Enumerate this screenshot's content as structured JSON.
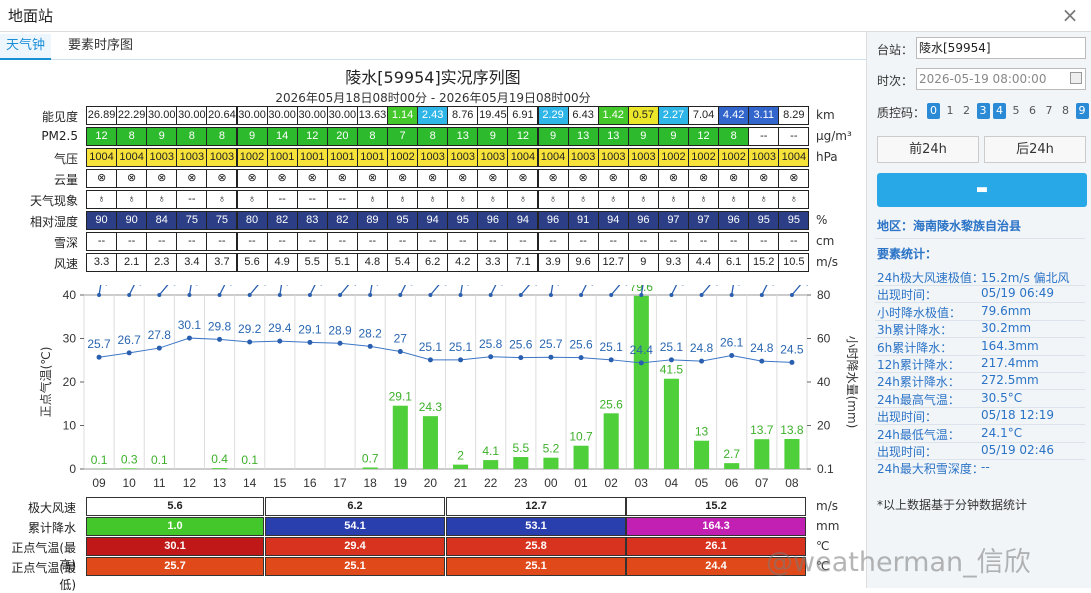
{
  "window": {
    "title": "地面站",
    "close": "×"
  },
  "tabs": [
    "天气钟",
    "要素时序图"
  ],
  "chart_title": "陵水[59954]实况序列图",
  "chart_subtitle": "2026年05月18日08时00分 - 2026年05月19日08时00分",
  "hours": [
    "09",
    "10",
    "11",
    "12",
    "13",
    "14",
    "15",
    "16",
    "17",
    "18",
    "19",
    "20",
    "21",
    "22",
    "23",
    "00",
    "01",
    "02",
    "03",
    "04",
    "05",
    "06",
    "07",
    "08"
  ],
  "table": {
    "rows": [
      {
        "label": "能见度",
        "unit": "km",
        "values": [
          "26.89",
          "22.29",
          "30.00",
          "30.00",
          "20.64",
          "30.00",
          "30.00",
          "30.00",
          "30.00",
          "13.63",
          "1.14",
          "2.43",
          "8.76",
          "19.45",
          "6.91",
          "2.29",
          "6.43",
          "1.42",
          "0.57",
          "2.27",
          "7.04",
          "4.42",
          "3.11",
          "8.29"
        ],
        "colors": [
          "#fff",
          "#fff",
          "#fff",
          "#fff",
          "#fff",
          "#fff",
          "#fff",
          "#fff",
          "#fff",
          "#fff",
          "#44c72a",
          "#2fb6e8",
          "#fff",
          "#fff",
          "#fff",
          "#2fb6e8",
          "#fff",
          "#44c72a",
          "#ece62a",
          "#2fb6e8",
          "#fff",
          "#3366cc",
          "#3366cc",
          "#fff"
        ]
      },
      {
        "label": "PM2.5",
        "unit": "μg/m³",
        "values": [
          "12",
          "8",
          "9",
          "8",
          "8",
          "9",
          "14",
          "12",
          "20",
          "8",
          "7",
          "8",
          "13",
          "9",
          "12",
          "9",
          "13",
          "13",
          "9",
          "9",
          "12",
          "8",
          "--",
          "--"
        ],
        "colors": "green"
      },
      {
        "label": "气压",
        "unit": "hPa",
        "values": [
          "1004",
          "1004",
          "1003",
          "1003",
          "1003",
          "1002",
          "1001",
          "1001",
          "1001",
          "1001",
          "1002",
          "1003",
          "1003",
          "1003",
          "1004",
          "1004",
          "1003",
          "1003",
          "1003",
          "1002",
          "1002",
          "1002",
          "1003",
          "1004"
        ],
        "colors": "yellow"
      },
      {
        "label": "云量",
        "unit": "",
        "values": [
          "⊗",
          "⊗",
          "⊗",
          "⊗",
          "⊗",
          "⊗",
          "⊗",
          "⊗",
          "⊗",
          "⊗",
          "⊗",
          "⊗",
          "⊗",
          "⊗",
          "⊗",
          "⊗",
          "⊗",
          "⊗",
          "⊗",
          "⊗",
          "⊗",
          "⊗",
          "⊗",
          "⊗"
        ],
        "colors": "white"
      },
      {
        "label": "天气现象",
        "unit": "",
        "values": [
          "♁",
          "♁",
          "♁",
          "--",
          "♁",
          "♁",
          "--",
          "--",
          "--",
          "♁",
          "♁",
          "♁",
          "♁",
          "♁",
          "♁",
          "♁",
          "♁",
          "♁",
          "♁",
          "♁",
          "♁",
          "♁",
          "♁",
          "♁"
        ],
        "colors": "white"
      },
      {
        "label": "相对湿度",
        "unit": "%",
        "values": [
          "90",
          "90",
          "84",
          "75",
          "75",
          "80",
          "82",
          "83",
          "82",
          "89",
          "95",
          "94",
          "95",
          "96",
          "94",
          "96",
          "91",
          "94",
          "96",
          "97",
          "97",
          "96",
          "95",
          "95"
        ],
        "colors": "navy"
      },
      {
        "label": "雪深",
        "unit": "cm",
        "values": [
          "--",
          "--",
          "--",
          "--",
          "--",
          "--",
          "--",
          "--",
          "--",
          "--",
          "--",
          "--",
          "--",
          "--",
          "--",
          "--",
          "--",
          "--",
          "--",
          "--",
          "--",
          "--",
          "--",
          "--"
        ],
        "colors": "white"
      },
      {
        "label": "风速",
        "unit": "m/s",
        "values": [
          "3.3",
          "2.1",
          "2.3",
          "3.4",
          "3.7",
          "5.6",
          "4.9",
          "5.5",
          "5.1",
          "4.8",
          "5.4",
          "6.2",
          "4.2",
          "3.3",
          "7.1",
          "3.9",
          "9.6",
          "12.7",
          "9",
          "9.3",
          "4.4",
          "6.1",
          "15.2",
          "10.5"
        ],
        "colors": "white"
      }
    ]
  },
  "chart_data": {
    "type": "bar",
    "categories": [
      "09",
      "10",
      "11",
      "12",
      "13",
      "14",
      "15",
      "16",
      "17",
      "18",
      "19",
      "20",
      "21",
      "22",
      "23",
      "00",
      "01",
      "02",
      "03",
      "04",
      "05",
      "06",
      "07",
      "08"
    ],
    "series": [
      {
        "name": "小时降水量",
        "values": [
          0.1,
          0.3,
          0.1,
          0,
          0.4,
          0.1,
          0,
          0,
          0,
          0.7,
          29.1,
          24.3,
          2,
          4.1,
          5.5,
          5.2,
          10.7,
          25.6,
          79.6,
          41.5,
          13,
          2.7,
          13.7,
          13.8
        ],
        "labels": [
          "0.1",
          "0.3",
          "0.1",
          "",
          "0.4",
          "0.1",
          "",
          "",
          "",
          "0.7",
          "29.1",
          "24.3",
          "2",
          "4.1",
          "5.5",
          "5.2",
          "10.7",
          "25.6",
          "79.6",
          "41.5",
          "13",
          "2.7",
          "13.7",
          "13.8"
        ]
      },
      {
        "name": "正点气温",
        "values": [
          25.7,
          26.7,
          27.8,
          30.1,
          29.8,
          29.2,
          29.4,
          29.1,
          28.9,
          28.2,
          27,
          25.1,
          25.1,
          25.8,
          25.6,
          25.7,
          25.6,
          25.1,
          24.4,
          25.1,
          24.8,
          26.1,
          24.8,
          24.5
        ],
        "labels": [
          "25.7",
          "26.7",
          "27.8",
          "30.1",
          "29.8",
          "29.2",
          "29.4",
          "29.1",
          "28.9",
          "28.2",
          "27",
          "25.1",
          "25.1",
          "25.8",
          "25.6",
          "25.7",
          "25.6",
          "25.1",
          "24.4",
          "25.1",
          "24.8",
          "26.1",
          "24.8",
          "24.5"
        ]
      }
    ],
    "ylabel_left": "正点气温(℃)",
    "ylabel_right": "小时降水量(mm)",
    "left_ticks": [
      "0",
      "10",
      "20",
      "30",
      "40"
    ],
    "right_ticks": [
      "0.1",
      "20",
      "40",
      "60",
      "80"
    ],
    "ylim_left": [
      0,
      40
    ],
    "ylim_right": [
      0,
      80
    ],
    "colors": {
      "bar": "#4fcf3a",
      "line": "#3c76c6",
      "label_bar": "#3db02a",
      "label_line": "#2a66b0"
    }
  },
  "bottom": {
    "rows": [
      {
        "label": "极大风速",
        "unit": "m/s",
        "values": [
          "5.6",
          "6.2",
          "12.7",
          "15.2"
        ],
        "colors": [
          "#fff",
          "#fff",
          "#fff",
          "#fff"
        ],
        "text": "#222"
      },
      {
        "label": "累计降水",
        "unit": "mm",
        "values": [
          "1.0",
          "54.1",
          "53.1",
          "164.3"
        ],
        "colors": [
          "#44c72a",
          "#2a3fae",
          "#2a3fae",
          "#c21fb3"
        ],
        "text": "#fff"
      },
      {
        "label": "正点气温(最高)",
        "unit": "℃",
        "values": [
          "30.1",
          "29.4",
          "25.8",
          "26.1"
        ],
        "colors": [
          "#c01818",
          "#d8331f",
          "#d8331f",
          "#d8331f"
        ],
        "text": "#fff"
      },
      {
        "label": "正点气温(最低)",
        "unit": "℃",
        "values": [
          "25.7",
          "25.1",
          "25.1",
          "24.4"
        ],
        "colors": [
          "#e04a1a",
          "#e04a1a",
          "#e04a1a",
          "#e04a1a"
        ],
        "text": "#fff"
      }
    ]
  },
  "side": {
    "station_label": "台站：",
    "station_value": "陵水[59954]",
    "time_label": "时次：",
    "time_value": "2026-05-19 08:00:00",
    "qc_label": "质控码：",
    "qc_codes": [
      "0",
      "1",
      "2",
      "3",
      "4",
      "5",
      "6",
      "7",
      "8",
      "9"
    ],
    "qc_on": [
      "0",
      "3",
      "4",
      "9"
    ],
    "prev_btn": "前24h",
    "next_btn": "后24h",
    "area": "地区：海南陵水黎族自治县",
    "stats_title": "要素统计：",
    "stats": [
      {
        "k": "24h极大风速极值：",
        "v": "15.2m/s 偏北风"
      },
      {
        "k": "出现时间：",
        "v": "05/19 06:49"
      },
      {
        "k": "小时降水极值：",
        "v": "79.6mm"
      },
      {
        "k": "3h累计降水：",
        "v": "30.2mm"
      },
      {
        "k": "6h累计降水：",
        "v": "164.3mm"
      },
      {
        "k": "12h累计降水：",
        "v": "217.4mm"
      },
      {
        "k": "24h累计降水：",
        "v": "272.5mm"
      },
      {
        "k": "24h最高气温：",
        "v": "30.5°C"
      },
      {
        "k": "出现时间：",
        "v": "05/18 12:19"
      },
      {
        "k": "24h最低气温：",
        "v": "24.1°C"
      },
      {
        "k": "出现时间：",
        "v": "05/19 02:46"
      },
      {
        "k": "24h最大积雪深度：",
        "v": "--"
      }
    ],
    "note": "*以上数据基于分钟数据统计"
  },
  "watermark": "@weatherman_信欣"
}
